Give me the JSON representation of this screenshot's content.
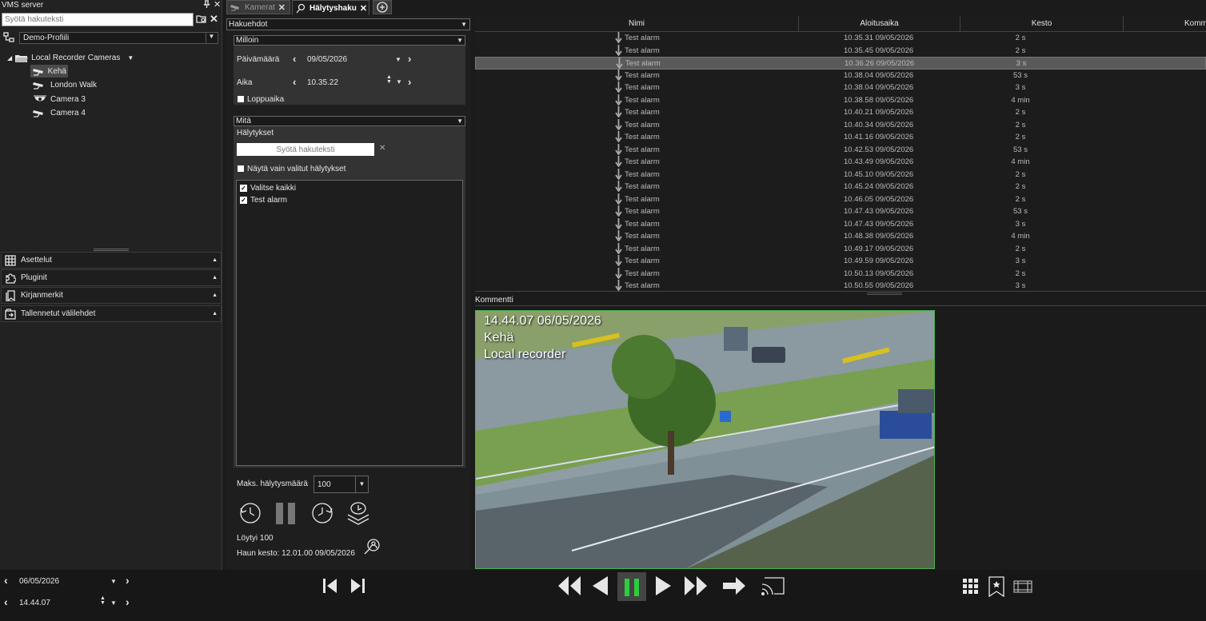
{
  "left": {
    "title": "VMS server",
    "search_placeholder": "Syötä hakuteksti",
    "profile": "Demo-Profiili",
    "tree": {
      "root": "Local Recorder Cameras",
      "cameras": [
        "Kehä",
        "London Walk",
        "Camera 3",
        "Camera 4"
      ]
    },
    "accordions": [
      "Asettelut",
      "Pluginit",
      "Kirjanmerkit",
      "Tallennetut välilehdet"
    ]
  },
  "tabs": [
    {
      "label": "Kamerat",
      "active": false
    },
    {
      "label": "Hälytyshaku",
      "active": true
    }
  ],
  "search": {
    "criteria_label": "Hakuehdot",
    "when_label": "Milloin",
    "date_label": "Päivämäärä",
    "date_value": "09/05/2026",
    "time_label": "Aika",
    "time_value": "10.35.22",
    "end_time_label": "Loppuaika",
    "what_label": "Mitä",
    "alarms_label": "Hälytykset",
    "alarm_search_placeholder": "Syötä hakuteksti",
    "show_selected_label": "Näytä vain valitut hälytykset",
    "select_all_label": "Valitse kaikki",
    "alarm_item": "Test alarm",
    "max_alarms_label": "Maks. hälytysmäärä",
    "max_alarms_value": "100",
    "found_text": "Löytyi 100",
    "duration_text": "Haun kesto: 12.01.00  09/05/2026"
  },
  "table": {
    "headers": [
      "Nimi",
      "Aloitusaika",
      "Kesto",
      "Komm"
    ],
    "rows": [
      [
        "Test alarm",
        "10.35.31  09/05/2026",
        "2 s"
      ],
      [
        "Test alarm",
        "10.35.45  09/05/2026",
        "2 s"
      ],
      [
        "Test alarm",
        "10.36.26  09/05/2026",
        "3 s"
      ],
      [
        "Test alarm",
        "10.38.04  09/05/2026",
        "53 s"
      ],
      [
        "Test alarm",
        "10.38.04  09/05/2026",
        "3 s"
      ],
      [
        "Test alarm",
        "10.38.58  09/05/2026",
        "4 min"
      ],
      [
        "Test alarm",
        "10.40.21  09/05/2026",
        "2 s"
      ],
      [
        "Test alarm",
        "10.40.34  09/05/2026",
        "2 s"
      ],
      [
        "Test alarm",
        "10.41.16  09/05/2026",
        "2 s"
      ],
      [
        "Test alarm",
        "10.42.53  09/05/2026",
        "53 s"
      ],
      [
        "Test alarm",
        "10.43.49  09/05/2026",
        "4 min"
      ],
      [
        "Test alarm",
        "10.45.10  09/05/2026",
        "2 s"
      ],
      [
        "Test alarm",
        "10.45.24  09/05/2026",
        "2 s"
      ],
      [
        "Test alarm",
        "10.46.05  09/05/2026",
        "2 s"
      ],
      [
        "Test alarm",
        "10.47.43  09/05/2026",
        "53 s"
      ],
      [
        "Test alarm",
        "10.47.43  09/05/2026",
        "3 s"
      ],
      [
        "Test alarm",
        "10.48.38  09/05/2026",
        "4 min"
      ],
      [
        "Test alarm",
        "10.49.17  09/05/2026",
        "2 s"
      ],
      [
        "Test alarm",
        "10.49.59  09/05/2026",
        "3 s"
      ],
      [
        "Test alarm",
        "10.50.13  09/05/2026",
        "2 s"
      ],
      [
        "Test alarm",
        "10.50.55  09/05/2026",
        "3 s"
      ]
    ],
    "selected_index": 2
  },
  "comment_label": "Kommentti",
  "video": {
    "timestamp": "14.44.07  06/05/2026",
    "camera": "Kehä",
    "source": "Local recorder"
  },
  "bottom": {
    "date_value": "06/05/2026",
    "time_value": "14.44.07"
  },
  "colors": {
    "accent_green": "#4caf50",
    "selected_row": "#5a5a5a"
  }
}
